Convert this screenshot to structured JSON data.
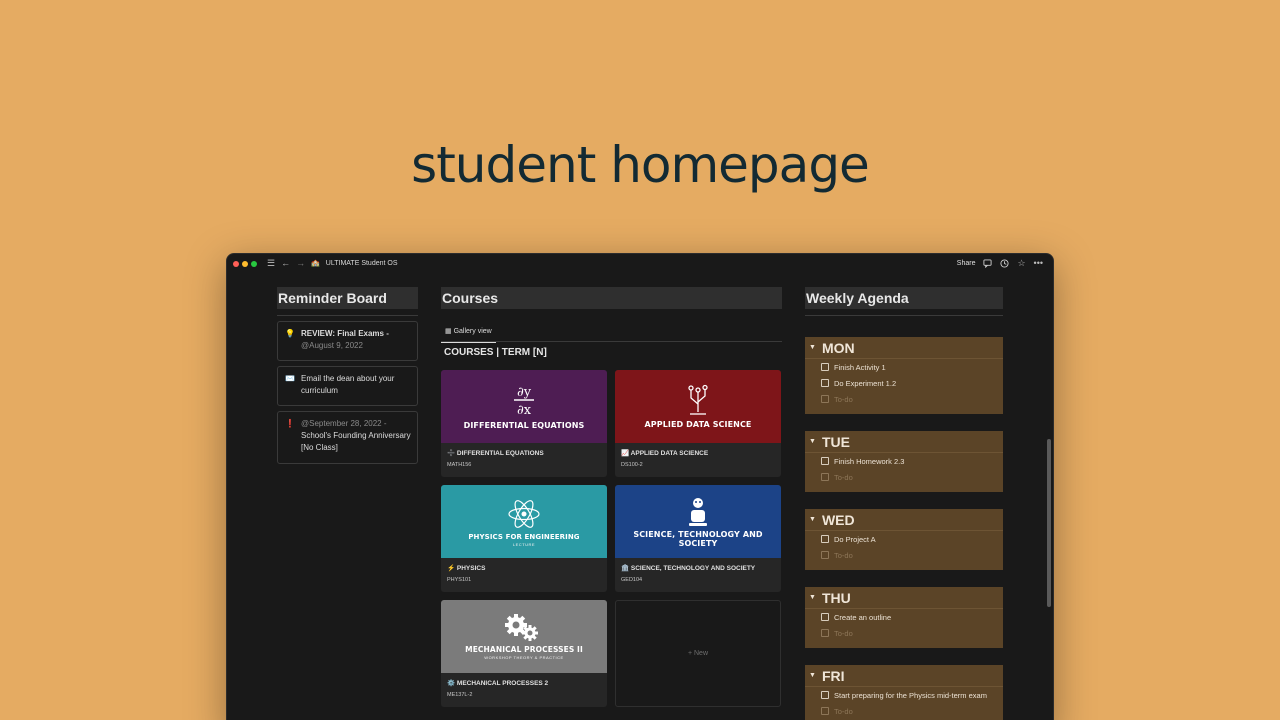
{
  "hero": {
    "title": "student homepage"
  },
  "window": {
    "title": "ULTIMATE Student OS",
    "title_icon": "school-emoji",
    "share_label": "Share",
    "traffic_lights": [
      "#FF5F57",
      "#FEBC2E",
      "#28C840"
    ]
  },
  "reminder_board": {
    "title": "Reminder Board",
    "items": [
      {
        "icon": "lightbulb-icon",
        "glyph": "💡",
        "text": "REVIEW: Final Exams -",
        "date": "@August 9, 2022"
      },
      {
        "icon": "envelope-icon",
        "glyph": "✉️",
        "text": "Email the dean about your curriculum"
      },
      {
        "icon": "exclamation-icon",
        "glyph": "❗",
        "date": "@September 28, 2022",
        "suffix": " -",
        "text": "School's Founding Anniversary [No Class]"
      }
    ]
  },
  "courses": {
    "title": "Courses",
    "view_tab": "Gallery view",
    "subtitle": "COURSES | TERM [N]",
    "new_label": "+ New",
    "cards": [
      {
        "cover_label": "DIFFERENTIAL EQUATIONS",
        "cover_sub": "",
        "title": "➗ DIFFERENTIAL EQUATIONS",
        "code": "MATH156",
        "color": "#4E1D53"
      },
      {
        "cover_label": "APPLIED DATA SCIENCE",
        "cover_sub": "",
        "title": "📈 APPLIED DATA SCIENCE",
        "code": "DS100-2",
        "color": "#7E1519"
      },
      {
        "cover_label": "PHYSICS FOR ENGINEERING",
        "cover_sub": "LECTURE",
        "title": "⚡ PHYSICS",
        "code": "PHYS101",
        "color": "#2A9AA4"
      },
      {
        "cover_label": "SCIENCE, TECHNOLOGY AND SOCIETY",
        "cover_sub": "",
        "title": "🏛️ SCIENCE, TECHNOLOGY AND SOCIETY",
        "code": "GED104",
        "color": "#1C4387"
      },
      {
        "cover_label": "MECHANICAL PROCESSES II",
        "cover_sub": "WORKSHOP THEORY & PRACTICE",
        "title": "⚙️ MECHANICAL PROCESSES 2",
        "code": "ME137L-2",
        "color": "#7B7B7B"
      }
    ]
  },
  "agenda": {
    "title": "Weekly Agenda",
    "placeholder": "To-do",
    "days": [
      {
        "name": "MON",
        "tasks": [
          "Finish Activity 1",
          "Do Experiment 1.2"
        ]
      },
      {
        "name": "TUE",
        "tasks": [
          "Finish Homework 2.3"
        ]
      },
      {
        "name": "WED",
        "tasks": [
          "Do Project A"
        ]
      },
      {
        "name": "THU",
        "tasks": [
          "Create an outline"
        ]
      },
      {
        "name": "FRI",
        "tasks": [
          "Start preparing for the Physics mid-term exam"
        ]
      }
    ]
  }
}
